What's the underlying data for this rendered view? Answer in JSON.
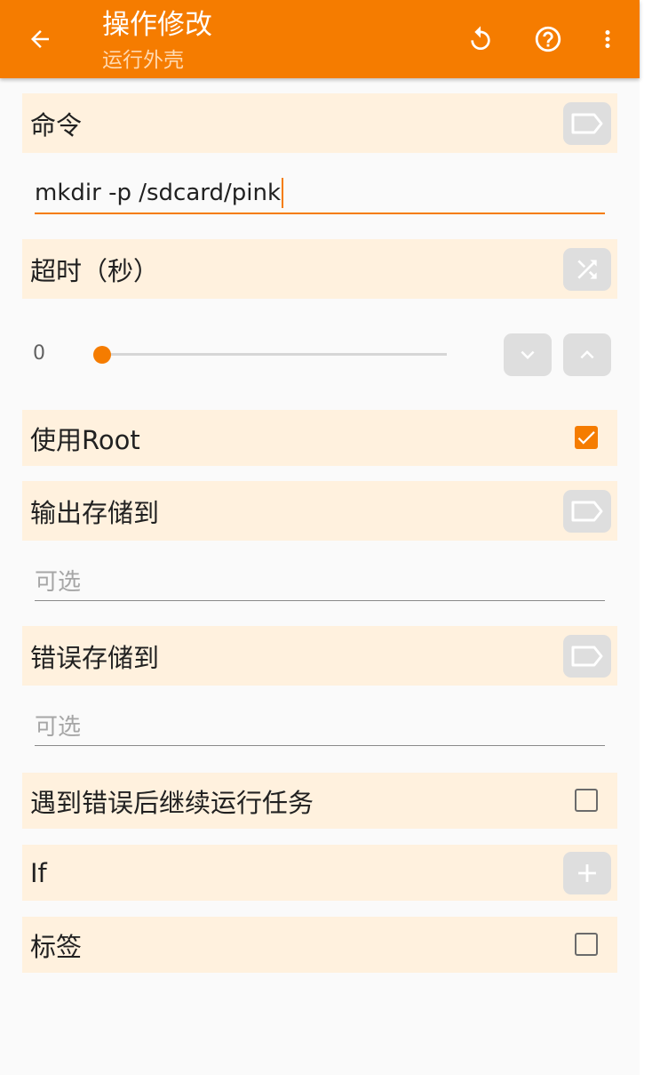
{
  "appbar": {
    "title": "操作修改",
    "subtitle": "运行外壳",
    "back_icon": "arrow-back-icon",
    "undo_icon": "undo-icon",
    "help_icon": "help-circle-icon",
    "more_icon": "more-vert-icon"
  },
  "command": {
    "label": "命令",
    "value": "mkdir -p /sdcard/pink"
  },
  "timeout": {
    "label": "超时（秒）",
    "value": "0"
  },
  "use_root": {
    "label": "使用Root",
    "checked": true
  },
  "output_store": {
    "label": "输出存储到",
    "placeholder": "可选"
  },
  "error_store": {
    "label": "错误存储到",
    "placeholder": "可选"
  },
  "continue_on_error": {
    "label": "遇到错误后继续运行任务",
    "checked": false
  },
  "if_condition": {
    "label": "If"
  },
  "tag": {
    "label": "标签",
    "checked": false
  },
  "colors": {
    "accent": "#f57c00",
    "row_bg": "#fff1de",
    "button_bg": "#dedede"
  }
}
